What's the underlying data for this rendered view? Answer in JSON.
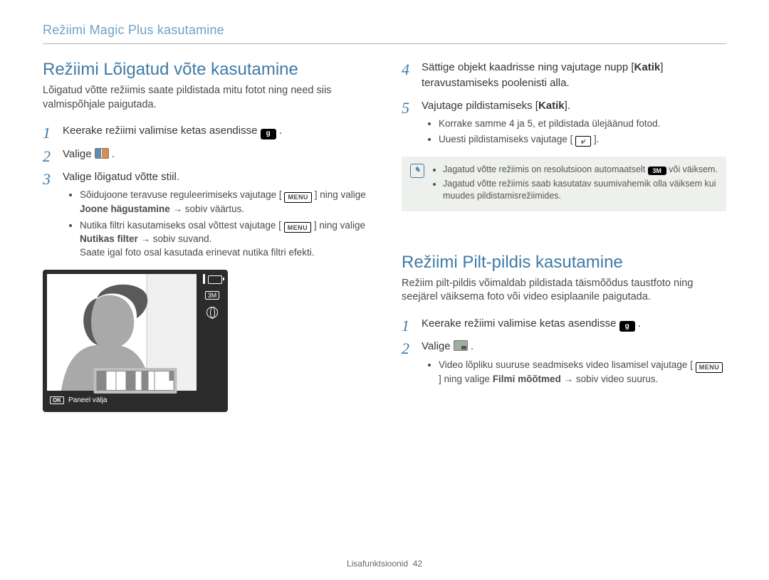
{
  "header": "Režiimi Magic Plus kasutamine",
  "footer": {
    "section": "Lisafunktsioonid",
    "page": "42"
  },
  "left": {
    "title": "Režiimi Lõigatud võte kasutamine",
    "intro": "Lõigatud võtte režiimis saate pildistada mitu fotot ning need siis valmispõhjale paigutada.",
    "step1_a": "Keerake režiimi valimise ketas asendisse ",
    "step1_icon": "g",
    "step2_a": "Valige ",
    "step3_a": "Valige lõigatud võtte stiil.",
    "bullet3a_a": "Sõidujoone teravuse reguleerimiseks vajutage [",
    "bullet3a_b": "] ning valige ",
    "bullet3a_bold": "Joone hägustamine",
    "bullet3a_c": " → sobiv väärtus.",
    "bullet3b_a": "Nutika filtri kasutamiseks osal võttest vajutage [",
    "bullet3b_b": "] ning valige ",
    "bullet3b_bold": "Nutikas filter",
    "bullet3b_c": " → sobiv suvand.",
    "bullet3b_tail": "Saate igal foto osal kasutada erinevat nutika filtri efekti.",
    "camera": {
      "badge": "3M",
      "bottom_label": "Paneel välja",
      "ok": "OK"
    }
  },
  "rightA": {
    "step4_a": "Sättige objekt kaadrisse ning vajutage nupp [",
    "step4_bold": "Katik",
    "step4_b": "] teravustamiseks poolenisti alla.",
    "step5_a": "Vajutage pildistamiseks [",
    "step5_bold": "Katik",
    "step5_b": "].",
    "bullet5a": "Korrake samme 4 ja 5, et pildistada ülejäänud fotod.",
    "bullet5b_a": "Uuesti pildistamiseks vajutage [",
    "bullet5b_b": "].",
    "note1_a": "Jagatud võtte režiimis on resolutsioon automaatselt ",
    "note1_pill": "3M",
    "note1_b": " või väiksem.",
    "note2": "Jagatud võtte režiimis saab kasutatav suumivahemik olla väiksem kui muudes pildistamisrežiimides."
  },
  "rightB": {
    "title": "Režiimi Pilt-pildis kasutamine",
    "intro": "Režiim pilt-pildis võimaldab pildistada täismõõdus taustfoto ning seejärel väiksema foto või video esiplaanile paigutada.",
    "step1_a": "Keerake režiimi valimise ketas asendisse ",
    "step1_icon": "g",
    "step2_a": "Valige ",
    "bullet2a_a": "Video lõpliku suuruse seadmiseks video lisamisel vajutage [",
    "bullet2a_b": "] ning valige ",
    "bullet2a_bold": "Filmi mõõtmed",
    "bullet2a_c": " → sobiv video suurus."
  },
  "labels": {
    "menu": "MENU"
  }
}
